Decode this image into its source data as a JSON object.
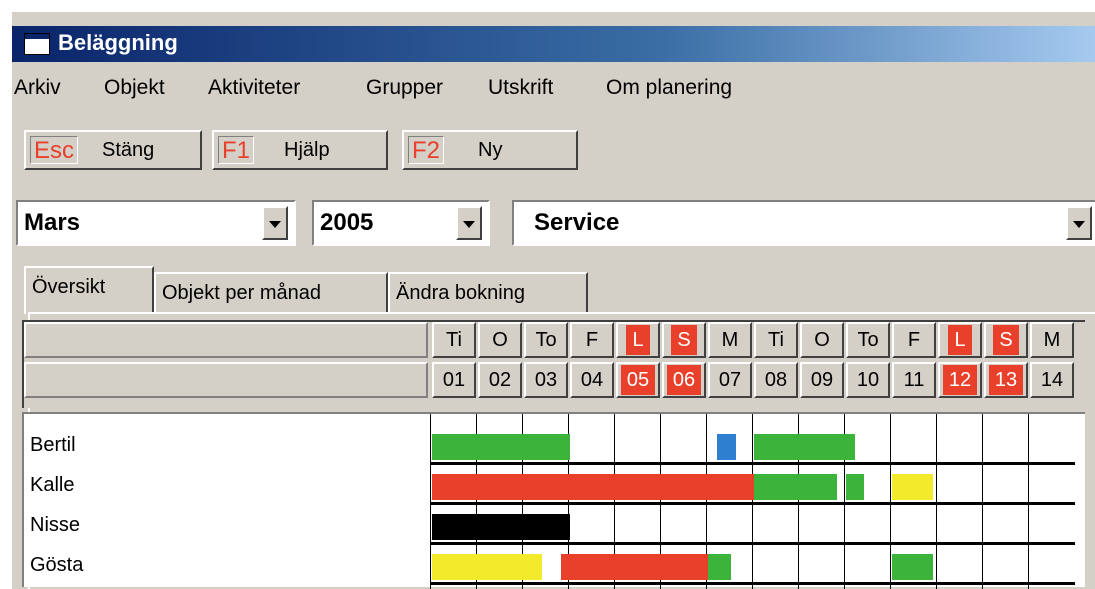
{
  "window": {
    "title": "Beläggning"
  },
  "menu": [
    "Arkiv",
    "Objekt",
    "Aktiviteter",
    "Grupper",
    "Utskrift",
    "Om planering"
  ],
  "toolbar": {
    "buttons": [
      {
        "key": "Esc",
        "label": "Stäng"
      },
      {
        "key": "F1",
        "label": "Hjälp"
      },
      {
        "key": "F2",
        "label": "Ny"
      }
    ]
  },
  "selectors": {
    "month": "Mars",
    "year": "2005",
    "group": "Service"
  },
  "tabs": [
    "Översikt",
    "Objekt per månad",
    "Ändra bokning"
  ],
  "active_tab": "Översikt",
  "colors": {
    "weekend": "#e8402a",
    "green": "#3cb43c",
    "red": "#e8402a",
    "yellow": "#f2ea2a",
    "blue": "#2f7fd0",
    "black": "#000000"
  },
  "days": [
    {
      "wd": "Ti",
      "date": "01",
      "weekend": false
    },
    {
      "wd": "O",
      "date": "02",
      "weekend": false
    },
    {
      "wd": "To",
      "date": "03",
      "weekend": false
    },
    {
      "wd": "F",
      "date": "04",
      "weekend": false
    },
    {
      "wd": "L",
      "date": "05",
      "weekend": true
    },
    {
      "wd": "S",
      "date": "06",
      "weekend": true
    },
    {
      "wd": "M",
      "date": "07",
      "weekend": false
    },
    {
      "wd": "Ti",
      "date": "08",
      "weekend": false
    },
    {
      "wd": "O",
      "date": "09",
      "weekend": false
    },
    {
      "wd": "To",
      "date": "10",
      "weekend": false
    },
    {
      "wd": "F",
      "date": "11",
      "weekend": false
    },
    {
      "wd": "L",
      "date": "12",
      "weekend": true
    },
    {
      "wd": "S",
      "date": "13",
      "weekend": true
    },
    {
      "wd": "M",
      "date": "14",
      "weekend": false
    }
  ],
  "resources": [
    {
      "name": "Bertil",
      "bookings": [
        {
          "color": "green",
          "start": 1,
          "end": 4
        },
        {
          "color": "blue",
          "start": 7.2,
          "end": 7.6
        },
        {
          "color": "green",
          "start": 8,
          "end": 10.2
        }
      ]
    },
    {
      "name": "Kalle",
      "bookings": [
        {
          "color": "red",
          "start": 1,
          "end": 8
        },
        {
          "color": "green",
          "start": 8,
          "end": 9.8
        },
        {
          "color": "green",
          "start": 10,
          "end": 10.4
        },
        {
          "color": "yellow",
          "start": 11,
          "end": 11.9
        }
      ]
    },
    {
      "name": "Nisse",
      "bookings": [
        {
          "color": "black",
          "start": 1,
          "end": 4
        }
      ]
    },
    {
      "name": "Gösta",
      "bookings": [
        {
          "color": "yellow",
          "start": 1,
          "end": 3.4
        },
        {
          "color": "red",
          "start": 3.8,
          "end": 7
        },
        {
          "color": "green",
          "start": 7,
          "end": 7.5
        },
        {
          "color": "green",
          "start": 11,
          "end": 11.9
        }
      ]
    }
  ]
}
